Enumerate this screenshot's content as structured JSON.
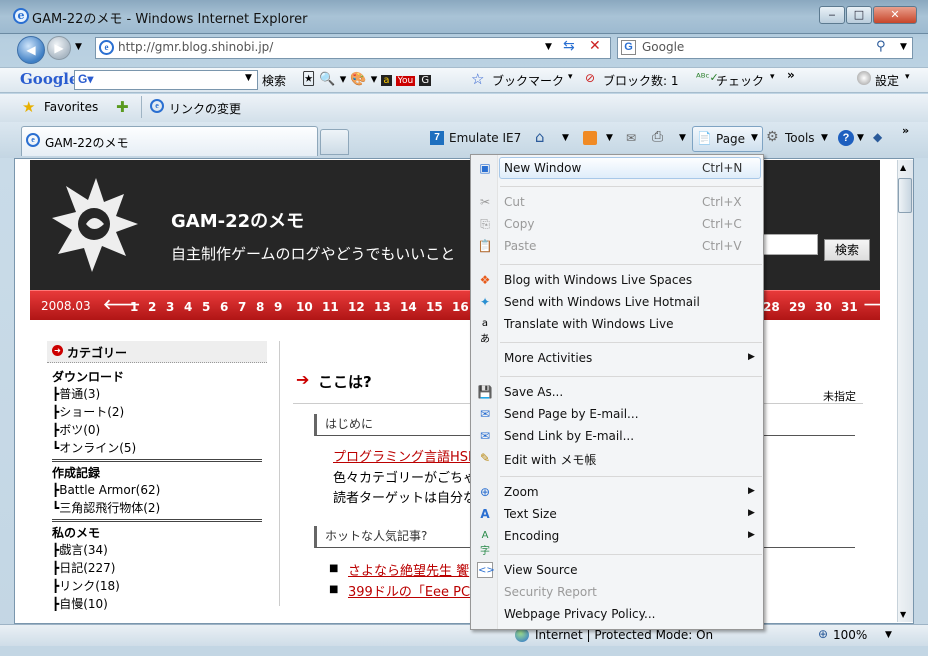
{
  "window": {
    "title": "GAM-22のメモ - Windows Internet Explorer",
    "min": "‒",
    "max": "□",
    "close": "✕"
  },
  "nav": {
    "url": "http://gmr.blog.shinobi.jp/",
    "search_placeholder": "Google"
  },
  "googlebar": {
    "logo": "Google",
    "search_label": "検索",
    "bookmark": "ブックマーク",
    "block": "ブロック数: 1",
    "check": "チェック",
    "more": "»",
    "settings": "設定"
  },
  "favbar": {
    "favorites": "Favorites",
    "link": "リンクの変更"
  },
  "tab": {
    "label": "GAM-22のメモ"
  },
  "commandbar": {
    "emulate": "Emulate IE7",
    "page": "Page",
    "tools": "Tools",
    "more": "»"
  },
  "blog": {
    "title": "GAM-22のメモ",
    "subtitle": "自主制作ゲームのログやどうでもいいこと",
    "search_btn": "検索",
    "month": "2008.03",
    "days": [
      "1",
      "2",
      "3",
      "4",
      "5",
      "6",
      "7",
      "8",
      "9",
      "10",
      "11",
      "12",
      "13",
      "14",
      "15",
      "16"
    ],
    "days_right": [
      "28",
      "29",
      "30",
      "31"
    ],
    "sidebar_title": "カテゴリー",
    "groups": [
      {
        "head": "ダウンロード",
        "items": [
          "┣普通(3)",
          "┣ショート(2)",
          "┣ボツ(0)",
          "┗オンライン(5)"
        ]
      },
      {
        "head": "作成記録",
        "items": [
          "┣Battle Armor(62)",
          "┗三角認飛行物体(2)"
        ]
      },
      {
        "head": "私のメモ",
        "items": [
          "┣戯言(34)",
          "┣日記(227)",
          "┣リンク(18)",
          "┣自慢(10)"
        ]
      }
    ],
    "main_heading": "ここは?",
    "unset": "未指定",
    "section1": "はじめに",
    "link1": "プログラミング言語HSP",
    "text1": "色々カテゴリーがごちゃ",
    "text2": "読者ターゲットは自分な",
    "section2": "ホットな人気記事?",
    "hot1": "さよなら絶望先生 饗",
    "hot2": "399ドルの「Eee PC"
  },
  "menu": {
    "new_window": "New Window",
    "new_window_sc": "Ctrl+N",
    "cut": "Cut",
    "cut_sc": "Ctrl+X",
    "copy": "Copy",
    "copy_sc": "Ctrl+C",
    "paste": "Paste",
    "paste_sc": "Ctrl+V",
    "blog_spaces": "Blog with Windows Live Spaces",
    "send_hotmail": "Send with Windows Live Hotmail",
    "translate": "Translate with Windows Live",
    "more_activities": "More Activities",
    "save_as": "Save As...",
    "send_page": "Send Page by E-mail...",
    "send_link": "Send Link by E-mail...",
    "edit_with": "Edit with メモ帳",
    "zoom": "Zoom",
    "text_size": "Text Size",
    "encoding": "Encoding",
    "view_source": "View Source",
    "security_report": "Security Report",
    "privacy_policy": "Webpage Privacy Policy..."
  },
  "status": {
    "zone": "Internet | Protected Mode: On",
    "zoom": "100%"
  }
}
